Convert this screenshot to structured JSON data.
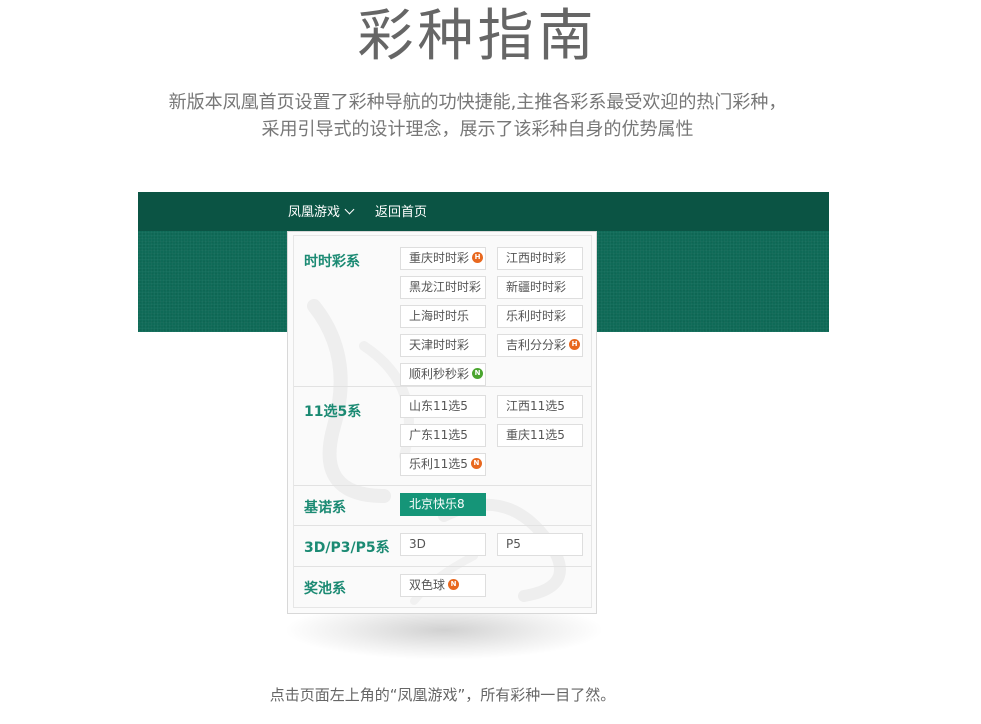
{
  "title": "彩种指南",
  "description": [
    "新版本凤凰首页设置了彩种导航的功快捷能,主推各彩系最受欢迎的热门彩种，",
    "采用引导式的设计理念，展示了该彩种自身的优势属性"
  ],
  "nav": {
    "games_label": "凤凰游戏",
    "home_label": "返回首页"
  },
  "colors": {
    "banner": "#0f6a57",
    "navbar": "#0b5444",
    "accent": "#159578",
    "label": "#1b8a73",
    "badge_hot": "#e8681f",
    "badge_new": "#4aa52e"
  },
  "menu": {
    "sections": [
      {
        "label": "时时彩系",
        "items": [
          {
            "label": "重庆时时彩",
            "badge": "H",
            "badge_type": "hot"
          },
          {
            "label": "江西时时彩"
          },
          {
            "label": "黑龙江时时彩"
          },
          {
            "label": "新疆时时彩"
          },
          {
            "label": "上海时时乐"
          },
          {
            "label": "乐利时时彩"
          },
          {
            "label": "天津时时彩"
          },
          {
            "label": "吉利分分彩",
            "badge": "H",
            "badge_type": "hot"
          },
          {
            "label": "顺利秒秒彩",
            "badge": "N",
            "badge_type": "new"
          }
        ]
      },
      {
        "label": "11选5系",
        "items": [
          {
            "label": "山东11选5"
          },
          {
            "label": "江西11选5"
          },
          {
            "label": "广东11选5"
          },
          {
            "label": "重庆11选5"
          },
          {
            "label": "乐利11选5",
            "badge": "N",
            "badge_type": "hot"
          }
        ]
      },
      {
        "label": "基诺系",
        "items": [
          {
            "label": "北京快乐8",
            "active": true
          }
        ]
      },
      {
        "label": "3D/P3/P5系",
        "items": [
          {
            "label": "3D"
          },
          {
            "label": "P5"
          }
        ]
      },
      {
        "label": "奖池系",
        "items": [
          {
            "label": "双色球",
            "badge": "N",
            "badge_type": "hot"
          }
        ]
      }
    ]
  },
  "footer": "点击页面左上角的“凤凰游戏”，所有彩种一目了然。"
}
